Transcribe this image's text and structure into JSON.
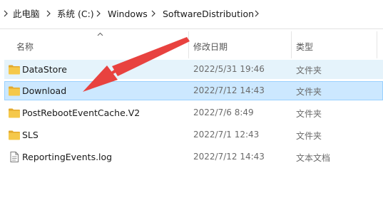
{
  "breadcrumb": {
    "items": [
      "此电脑",
      "系统 (C:)",
      "Windows",
      "SoftwareDistribution"
    ]
  },
  "columns": {
    "name": "名称",
    "date_modified": "修改日期",
    "type": "类型"
  },
  "files": [
    {
      "name": "DataStore",
      "date": "2022/5/31 19:46",
      "type": "文件夹",
      "icon": "folder-icon",
      "state": "hover"
    },
    {
      "name": "Download",
      "date": "2022/7/12 14:43",
      "type": "文件夹",
      "icon": "folder-icon",
      "state": "selected"
    },
    {
      "name": "PostRebootEventCache.V2",
      "date": "2022/7/6 8:49",
      "type": "文件夹",
      "icon": "folder-icon",
      "state": "normal"
    },
    {
      "name": "SLS",
      "date": "2022/7/1 12:43",
      "type": "文件夹",
      "icon": "folder-icon",
      "state": "normal"
    },
    {
      "name": "ReportingEvents.log",
      "date": "2022/7/12 14:43",
      "type": "文本文档",
      "icon": "text-file-icon",
      "state": "normal"
    }
  ],
  "colors": {
    "hover_row": "#e5f3fb",
    "selected_row": "#cce8ff",
    "folder": "#f5c84a",
    "annotation_arrow": "#e8423f"
  }
}
